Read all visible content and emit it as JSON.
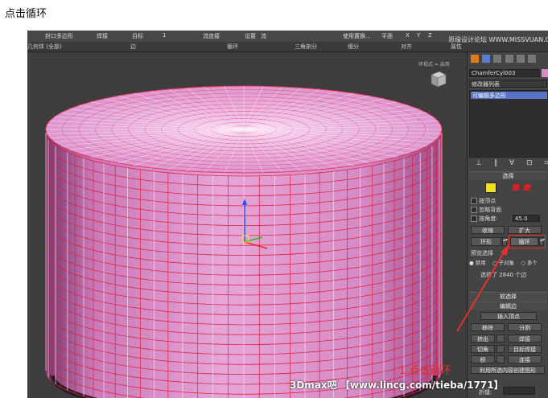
{
  "caption": "点击循环",
  "toolbar": {
    "items": [
      "封口多边形",
      "焊接",
      "目标",
      "1",
      "流连接",
      "设置",
      "流",
      "使用置换...",
      "平面",
      "X",
      "Y",
      "Z"
    ]
  },
  "ribbon": {
    "items": [
      "几何体 (全部)",
      "边",
      "循环",
      "三角剖分",
      "细分",
      "对齐",
      "属性"
    ]
  },
  "site_logo": "思缘设计论坛 WWW.MISSVUAN.COM",
  "viewport": {
    "label": "环视式 = 启用"
  },
  "panel": {
    "object_name": "ChamferCyl003",
    "modifier_list": "修改器列表",
    "stack_item": "可编辑多边形",
    "select_section": "选择",
    "by_vertex": "按顶点",
    "ignore_backface": "忽略背面",
    "by_angle": "按角度:",
    "angle_value": "45.0",
    "shrink": "收缩",
    "grow": "扩大",
    "ring": "环形",
    "loop": "循环",
    "preview_label": "预览选择",
    "preview_options": [
      "禁用",
      "子对象",
      "多个"
    ],
    "selected_count": "选择了 2840 个边",
    "soft_select": "软选择",
    "edit_edges": "编辑边",
    "insert_vertex": "插入顶点",
    "remove": "移除",
    "split": "分割",
    "extrude": "挤出",
    "weld": "焊接",
    "chamfer": "切角",
    "target_weld": "目标焊接",
    "bridge": "桥",
    "connect": "连接",
    "create_shape": "利用所选内容创建图形",
    "weight_label": "折缝:"
  },
  "annotation": "1.点击循环",
  "watermark": "3Dmax吧 【www.lincg.com/tieba/1771】",
  "colors": {
    "accent_red": "#e53030",
    "cylinder_pink": "#d98ac8",
    "wire_red": "#e02040",
    "app_bg": "#3c3c3c",
    "panel_bg": "#444444"
  }
}
